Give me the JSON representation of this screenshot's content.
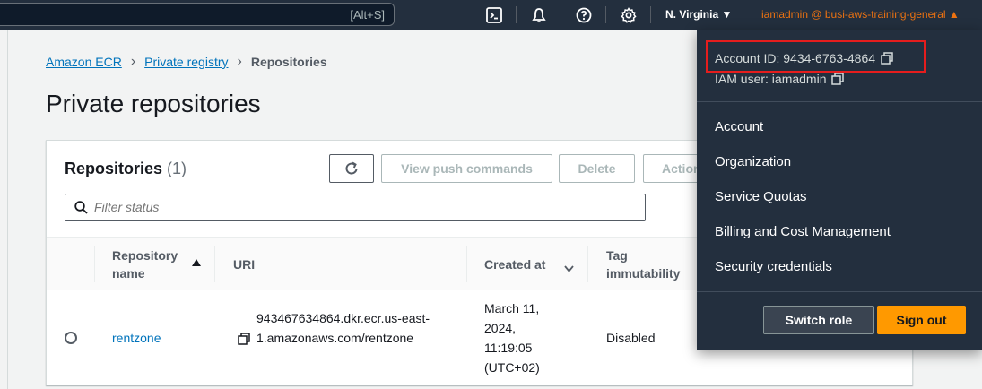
{
  "topbar": {
    "search_shortcut": "[Alt+S]",
    "region": "N. Virginia ▼",
    "account_menu": "iamadmin @ busi-aws-training-general ▲"
  },
  "breadcrumb": {
    "items": [
      "Amazon ECR",
      "Private registry"
    ],
    "current": "Repositories"
  },
  "page": {
    "title": "Private repositories"
  },
  "panel": {
    "title": "Repositories",
    "count": "(1)",
    "buttons": {
      "view_push": "View push commands",
      "delete": "Delete",
      "actions": "Actions"
    },
    "filter_placeholder": "Filter status"
  },
  "table": {
    "columns": {
      "name_line1": "Repository",
      "name_line2": "name",
      "uri": "URI",
      "created": "Created at",
      "tag_line1": "Tag",
      "tag_line2": "immutability"
    },
    "rows": [
      {
        "name": "rentzone",
        "uri_line1": "943467634864.dkr.ecr.us-east-",
        "uri_line2": "1.amazonaws.com/rentzone",
        "created_line1": "March 11,",
        "created_line2": "2024,",
        "created_line3": "11:19:05",
        "created_line4": "(UTC+02)",
        "tag_immutability": "Disabled"
      }
    ]
  },
  "dropdown": {
    "account_id": "Account ID: 9434-6763-4864",
    "iam_user": "IAM user: iamadmin",
    "items": [
      "Account",
      "Organization",
      "Service Quotas",
      "Billing and Cost Management",
      "Security credentials"
    ],
    "switch_role": "Switch role",
    "sign_out": "Sign out"
  },
  "colors": {
    "nav_bg": "#232f3e",
    "accent_orange": "#ec7211",
    "sign_out_bg": "#ff9900",
    "link_blue": "#0073bb",
    "highlight_red": "#e51d1d"
  }
}
